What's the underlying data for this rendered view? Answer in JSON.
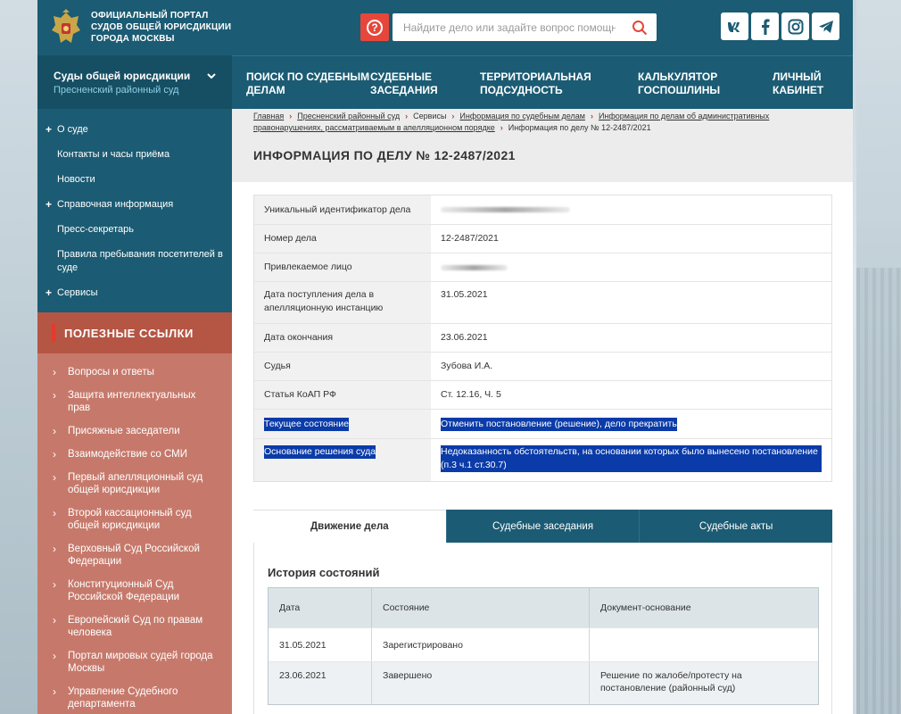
{
  "portal": {
    "title_line1": "Официальный портал",
    "title_line2": "судов общей юрисдикции",
    "title_line3": "города Москвы"
  },
  "search": {
    "placeholder": "Найдите дело или задайте вопрос помощнику"
  },
  "social": {
    "vk": "vk-icon",
    "facebook": "facebook-icon",
    "instagram": "instagram-icon",
    "telegram": "telegram-icon"
  },
  "court_selector": {
    "title": "Суды общей юрисдикции",
    "subtitle": "Пресненский районный суд"
  },
  "topnav": [
    {
      "label": "Поиск по судебным делам"
    },
    {
      "label": "Судебные заседания"
    },
    {
      "label": "Территориальная подсудность"
    },
    {
      "label": "Калькулятор госпошлины"
    },
    {
      "label": "Личный кабинет"
    }
  ],
  "sidebar": {
    "items": [
      {
        "label": "О суде",
        "expandable": true
      },
      {
        "label": "Контакты и часы приёма",
        "expandable": false
      },
      {
        "label": "Новости",
        "expandable": false
      },
      {
        "label": "Справочная информация",
        "expandable": true
      },
      {
        "label": "Пресс-секретарь",
        "expandable": false
      },
      {
        "label": "Правила пребывания посетителей в суде",
        "expandable": false
      },
      {
        "label": "Сервисы",
        "expandable": true
      }
    ],
    "links_title": "Полезные ссылки",
    "links": [
      "Вопросы и ответы",
      "Защита интеллектуальных прав",
      "Присяжные заседатели",
      "Взаимодействие со СМИ",
      "Первый апелляционный суд общей юрисдикции",
      "Второй кассационный суд общей юрисдикции",
      "Верховный Суд Российской Федерации",
      "Конституционный Суд Российской Федерации",
      "Европейский Суд по правам человека",
      "Портал мировых судей города Москвы",
      "Управление Судебного департамента"
    ]
  },
  "breadcrumbs": {
    "items": [
      "Главная",
      "Пресненский районный суд",
      "Сервисы",
      "Информация по судебным делам",
      "Информация по делам об административных правонарушениях, рассматриваемым в апелляционном порядке",
      "Информация по делу № 12-2487/2021"
    ]
  },
  "page": {
    "title": "Информация по делу № 12-2487/2021"
  },
  "case_info": [
    {
      "label": "Уникальный идентификатор дела",
      "value": "",
      "redacted": true
    },
    {
      "label": "Номер дела",
      "value": "12-2487/2021"
    },
    {
      "label": "Привлекаемое лицо",
      "value": "",
      "redacted": true
    },
    {
      "label": "Дата поступления дела в апелляционную инстанцию",
      "value": "31.05.2021"
    },
    {
      "label": "Дата окончания",
      "value": "23.06.2021"
    },
    {
      "label": "Судья",
      "value": "Зубова И.А."
    },
    {
      "label": "Статья КоАП РФ",
      "value": "Ст. 12.16, Ч. 5"
    },
    {
      "label": "Текущее состояние",
      "value": "Отменить постановление (решение), дело прекратить",
      "selected": true
    },
    {
      "label": "Основание решения суда",
      "value": "Недоказанность обстоятельств, на основании которых было вынесено постановление (п.3 ч.1 ст.30.7)",
      "selected": true
    }
  ],
  "tabs": [
    {
      "label": "Движение дела",
      "active": true
    },
    {
      "label": "Судебные заседания",
      "active": false
    },
    {
      "label": "Судебные акты",
      "active": false
    }
  ],
  "history": {
    "title": "История состояний",
    "columns": [
      "Дата",
      "Состояние",
      "Документ-основание"
    ],
    "rows": [
      [
        "31.05.2021",
        "Зарегистрировано",
        ""
      ],
      [
        "23.06.2021",
        "Завершено",
        "Решение по жалобе/протесту на постановление (районный суд)"
      ]
    ]
  },
  "colors": {
    "header_bg": "#1b5b73",
    "accent_red": "#e6473a",
    "links_bg": "#c6796b",
    "selection": "#0a3ba8"
  }
}
